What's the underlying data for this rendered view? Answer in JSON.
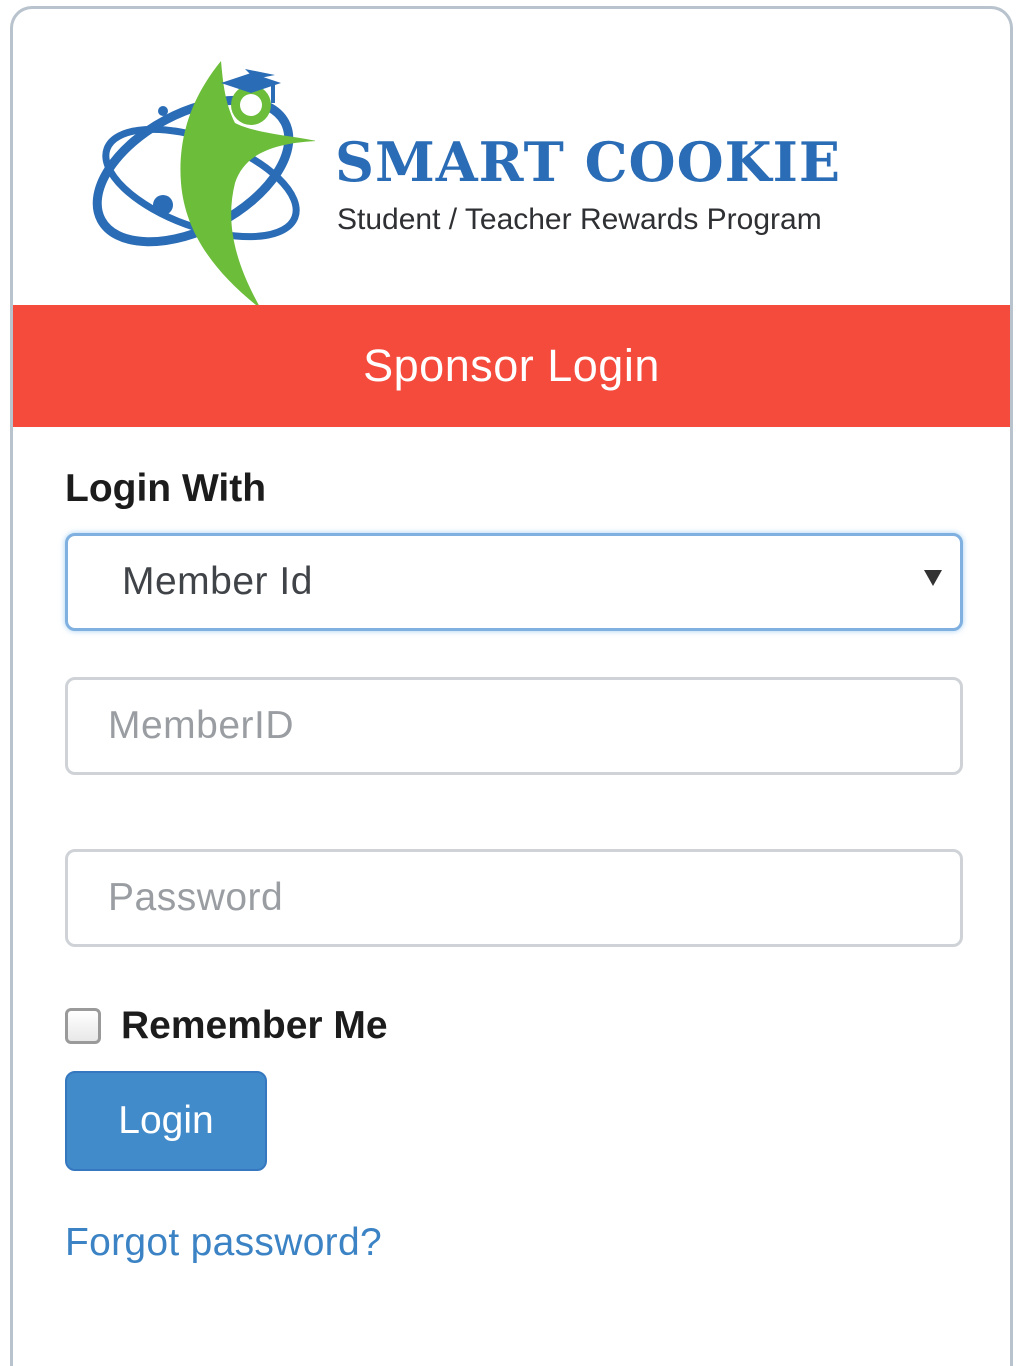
{
  "brand": {
    "name": "SMART COOKIE",
    "tagline": "Student / Teacher Rewards Program",
    "colors": {
      "blue": "#2a6cb5",
      "green": "#6cbd3a"
    }
  },
  "banner": {
    "title": "Sponsor Login",
    "color": "#f44b3c"
  },
  "form": {
    "login_with_label": "Login With",
    "login_with_select": {
      "selected": "Member Id"
    },
    "member_id_input": {
      "placeholder": "MemberID",
      "value": ""
    },
    "password_input": {
      "placeholder": "Password",
      "value": ""
    },
    "remember_me": {
      "label": "Remember Me",
      "checked": false
    },
    "login_button_label": "Login",
    "login_button_color": "#428bca",
    "forgot_password_link": "Forgot password?"
  }
}
